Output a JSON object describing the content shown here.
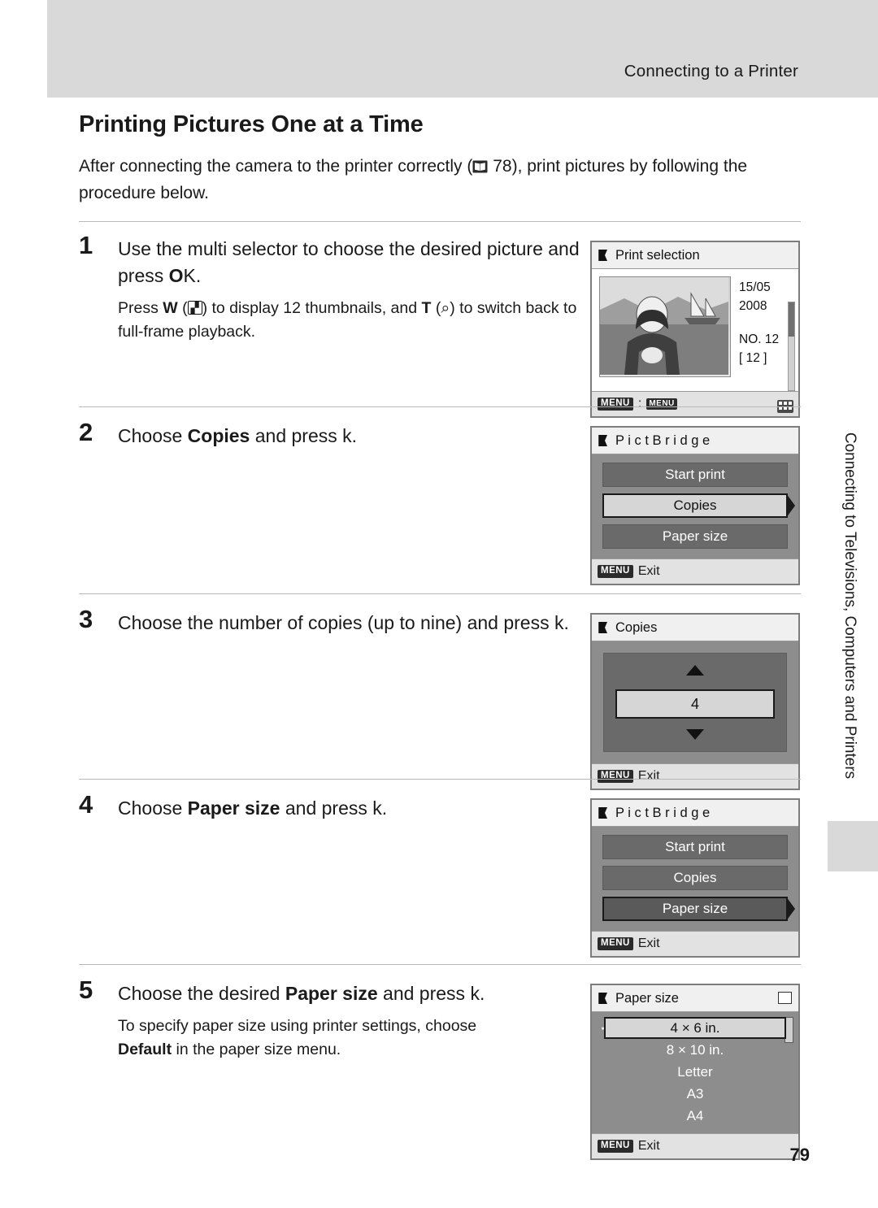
{
  "header": {
    "title": "Connecting to a Printer"
  },
  "side_tab": {
    "text": "Connecting to Televisions, Computers and Printers"
  },
  "page": {
    "number": "79"
  },
  "title": "Printing Pictures One at a Time",
  "intro": {
    "before_ref": "After connecting the camera to the printer correctly (",
    "ref_page": "78",
    "after_ref": "), print pictures by following the procedure below."
  },
  "steps": [
    {
      "num": "1",
      "headline_a": "Use the multi selector to choose the desired picture and press ",
      "headline_b": "k.",
      "sub_a": "Press ",
      "sub_w": "W",
      "sub_b": " (",
      "sub_c": ") to display 12 thumbnails, and ",
      "sub_t": "T",
      "sub_d": " (",
      "sub_e": ") to switch back to full-frame playback."
    },
    {
      "num": "2",
      "headline_plain_a": "Choose ",
      "headline_bold": "Copies",
      "headline_plain_b": " and press k."
    },
    {
      "num": "3",
      "headline": "Choose the number of copies (up to nine) and press k."
    },
    {
      "num": "4",
      "headline_plain_a": "Choose ",
      "headline_bold": "Paper size",
      "headline_plain_b": " and press k."
    },
    {
      "num": "5",
      "headline_plain_a": "Choose the desired ",
      "headline_bold": "Paper size",
      "headline_plain_b": " and press k.",
      "sub_a": "To specify paper size using printer settings, choose ",
      "sub_bold": "Default",
      "sub_b": " in the paper size menu."
    }
  ],
  "screens": {
    "print_selection": {
      "title": "Print selection",
      "date_day": "15/05",
      "date_year": "2008",
      "frame_label": "NO. 12",
      "count": "[   12 ]",
      "footer_menu": "MENU",
      "footer_sep": ":",
      "footer_badge": "MENU"
    },
    "pictbridge_copies": {
      "title": "P i c t B r i d g e",
      "items": [
        {
          "label": "Start print",
          "state": "normal"
        },
        {
          "label": "Copies",
          "state": "selected"
        },
        {
          "label": "Paper size",
          "state": "normal"
        }
      ],
      "footer_badge": "MENU",
      "footer_label": "Exit"
    },
    "copies": {
      "title": "Copies",
      "value": "4",
      "footer_badge": "MENU",
      "footer_label": "Exit"
    },
    "pictbridge_paper": {
      "title": "P i c t B r i d g e",
      "items": [
        {
          "label": "Start print",
          "state": "normal"
        },
        {
          "label": "Copies",
          "state": "normal"
        },
        {
          "label": "Paper size",
          "state": "selected"
        }
      ],
      "footer_badge": "MENU",
      "footer_label": "Exit"
    },
    "paper_size": {
      "title": "Paper size",
      "items": [
        "4 × 6 in.",
        "8 × 10 in.",
        "Letter",
        "A3",
        "A4"
      ],
      "selected_index": 0,
      "footer_badge": "MENU",
      "footer_label": "Exit"
    }
  }
}
